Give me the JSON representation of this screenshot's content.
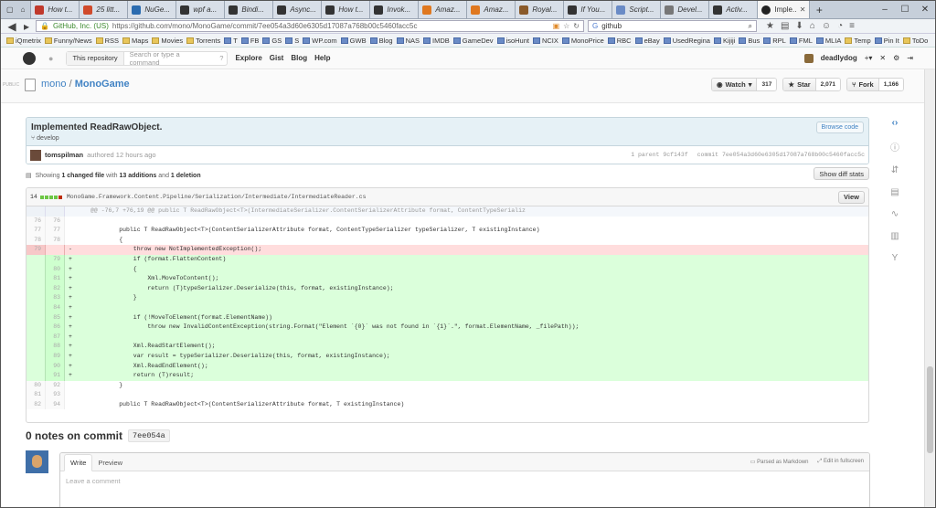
{
  "browser": {
    "tabs": [
      {
        "label": "How t...",
        "color": "#c0392b"
      },
      {
        "label": "25 litt...",
        "color": "#d04a2b"
      },
      {
        "label": "NuGe...",
        "color": "#2b6cb0"
      },
      {
        "label": "wpf a...",
        "color": "#333333"
      },
      {
        "label": "Bindi...",
        "color": "#333333"
      },
      {
        "label": "Async...",
        "color": "#333333"
      },
      {
        "label": "How t...",
        "color": "#333333"
      },
      {
        "label": "Invok...",
        "color": "#333333"
      },
      {
        "label": "Amaz...",
        "color": "#e0781f"
      },
      {
        "label": "Amaz...",
        "color": "#e0781f"
      },
      {
        "label": "Royal...",
        "color": "#8a5a2a"
      },
      {
        "label": "If You...",
        "color": "#333333"
      },
      {
        "label": "Script...",
        "color": "#6a8bc6"
      },
      {
        "label": "Devel...",
        "color": "#777777"
      },
      {
        "label": "Activ...",
        "color": "#333333"
      }
    ],
    "active_tab": "Imple...",
    "site_identity": "GitHub, Inc. (US)",
    "url": "https://github.com/mono/MonoGame/commit/7ee054a3d60e6305d17087a768b00c5460facc5c",
    "search_query": "github",
    "bookmarks": [
      {
        "label": "iQmetrix",
        "type": "folder"
      },
      {
        "label": "Funny/News",
        "type": "folder"
      },
      {
        "label": "RSS",
        "type": "folder"
      },
      {
        "label": "Maps",
        "type": "folder"
      },
      {
        "label": "Movies",
        "type": "folder"
      },
      {
        "label": "Torrents",
        "type": "folder"
      },
      {
        "label": "T",
        "type": "site"
      },
      {
        "label": "FB",
        "type": "site"
      },
      {
        "label": "GS",
        "type": "site"
      },
      {
        "label": "S",
        "type": "site"
      },
      {
        "label": "WP.com",
        "type": "site"
      },
      {
        "label": "GWB",
        "type": "site"
      },
      {
        "label": "Blog",
        "type": "site"
      },
      {
        "label": "NAS",
        "type": "site"
      },
      {
        "label": "IMDB",
        "type": "site"
      },
      {
        "label": "GameDev",
        "type": "site"
      },
      {
        "label": "isoHunt",
        "type": "site"
      },
      {
        "label": "NCIX",
        "type": "site"
      },
      {
        "label": "MonoPrice",
        "type": "site"
      },
      {
        "label": "RBC",
        "type": "site"
      },
      {
        "label": "eBay",
        "type": "site"
      },
      {
        "label": "UsedRegina",
        "type": "site"
      },
      {
        "label": "Kijiji",
        "type": "site"
      },
      {
        "label": "Bus",
        "type": "site"
      },
      {
        "label": "RPL",
        "type": "site"
      },
      {
        "label": "FML",
        "type": "site"
      },
      {
        "label": "MLIA",
        "type": "site"
      },
      {
        "label": "Temp",
        "type": "folder"
      },
      {
        "label": "Pin It",
        "type": "site"
      },
      {
        "label": "ToDo",
        "type": "folder"
      }
    ]
  },
  "github_header": {
    "scope_label": "This repository",
    "search_placeholder": "Search or type a command",
    "nav": [
      "Explore",
      "Gist",
      "Blog",
      "Help"
    ],
    "username": "deadlydog"
  },
  "repo": {
    "visibility": "PUBLIC",
    "owner": "mono",
    "separator": "/",
    "name": "MonoGame",
    "watch_label": "Watch",
    "watch_count": "317",
    "star_label": "Star",
    "star_count": "2,071",
    "fork_label": "Fork",
    "fork_count": "1,166"
  },
  "commit": {
    "title": "Implemented ReadRawObject.",
    "branch": "develop",
    "browse_code_label": "Browse code",
    "author": "tomspilman",
    "authored_text": "authored 12 hours ago",
    "parent_label": "1 parent",
    "parent_sha": "9cf143f",
    "commit_label": "commit",
    "commit_sha": "7ee054a3d60e6305d17087a768b00c5460facc5c"
  },
  "summary": {
    "showing": "Showing",
    "changed": "1 changed file",
    "with": "with",
    "additions": "13 additions",
    "and": "and",
    "deletions": "1 deletion",
    "toggle_label": "Show diff stats"
  },
  "file": {
    "change_count": "14",
    "path": "MonoGame.Framework.Content.Pipeline/Serialization/Intermediate/IntermediateReader.cs",
    "view_label": "View",
    "lines": [
      {
        "type": "hunk",
        "old": "",
        "new": "",
        "marker": "",
        "text": "@@ -76,7 +76,19 @@ public T ReadRawObject<T>(IntermediateSerializer.ContentSerializerAttribute format, ContentTypeSerializ"
      },
      {
        "type": "ctx",
        "old": "76",
        "new": "76",
        "marker": "",
        "text": "        "
      },
      {
        "type": "ctx",
        "old": "77",
        "new": "77",
        "marker": "",
        "text": "        public T ReadRawObject<T>(ContentSerializerAttribute format, ContentTypeSerializer typeSerializer, T existingInstance)"
      },
      {
        "type": "ctx",
        "old": "78",
        "new": "78",
        "marker": "",
        "text": "        {"
      },
      {
        "type": "del",
        "old": "79",
        "new": "",
        "marker": "-",
        "text": "            throw new NotImplementedException();"
      },
      {
        "type": "add",
        "old": "",
        "new": "79",
        "marker": "+",
        "text": "            if (format.FlattenContent)"
      },
      {
        "type": "add",
        "old": "",
        "new": "80",
        "marker": "+",
        "text": "            {"
      },
      {
        "type": "add",
        "old": "",
        "new": "81",
        "marker": "+",
        "text": "                Xml.MoveToContent();"
      },
      {
        "type": "add",
        "old": "",
        "new": "82",
        "marker": "+",
        "text": "                return (T)typeSerializer.Deserialize(this, format, existingInstance);"
      },
      {
        "type": "add",
        "old": "",
        "new": "83",
        "marker": "+",
        "text": "            }"
      },
      {
        "type": "add",
        "old": "",
        "new": "84",
        "marker": "+",
        "text": ""
      },
      {
        "type": "add",
        "old": "",
        "new": "85",
        "marker": "+",
        "text": "            if (!MoveToElement(format.ElementName))"
      },
      {
        "type": "add",
        "old": "",
        "new": "86",
        "marker": "+",
        "text": "                throw new InvalidContentException(string.Format(\"Element `{0}` was not found in `{1}`.\", format.ElementName, _filePath));"
      },
      {
        "type": "add",
        "old": "",
        "new": "87",
        "marker": "+",
        "text": ""
      },
      {
        "type": "add",
        "old": "",
        "new": "88",
        "marker": "+",
        "text": "            Xml.ReadStartElement();"
      },
      {
        "type": "add",
        "old": "",
        "new": "89",
        "marker": "+",
        "text": "            var result = typeSerializer.Deserialize(this, format, existingInstance);"
      },
      {
        "type": "add",
        "old": "",
        "new": "90",
        "marker": "+",
        "text": "            Xml.ReadEndElement();"
      },
      {
        "type": "add",
        "old": "",
        "new": "91",
        "marker": "+",
        "text": "            return (T)result;"
      },
      {
        "type": "ctx",
        "old": "80",
        "new": "92",
        "marker": "",
        "text": "        }"
      },
      {
        "type": "ctx",
        "old": "81",
        "new": "93",
        "marker": "",
        "text": ""
      },
      {
        "type": "ctx",
        "old": "82",
        "new": "94",
        "marker": "",
        "text": "        public T ReadRawObject<T>(ContentSerializerAttribute format, T existingInstance)"
      }
    ]
  },
  "notes": {
    "heading": "0 notes on commit",
    "sha": "7ee054a"
  },
  "comment": {
    "write_tab": "Write",
    "preview_tab": "Preview",
    "markdown_hint": "Parsed as Markdown",
    "fullscreen_hint": "Edit in fullscreen",
    "placeholder": "Leave a comment"
  }
}
